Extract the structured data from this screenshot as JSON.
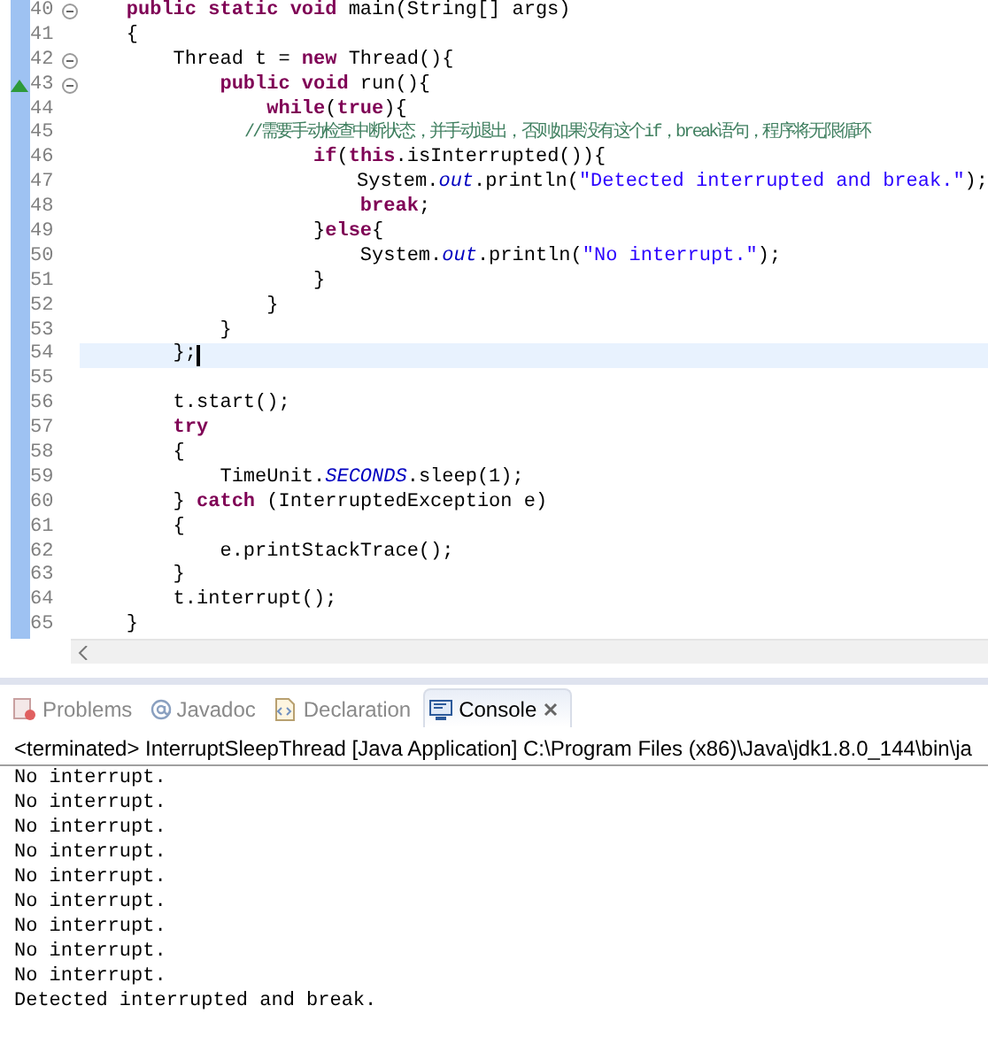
{
  "editor": {
    "lines": [
      {
        "number": "40",
        "fold": true,
        "current": false,
        "marker": false,
        "tokens": [
          {
            "kind": "keyword",
            "text": "    public static void"
          },
          {
            "kind": "plain",
            "text": " main(String[] args)"
          }
        ]
      },
      {
        "number": "41",
        "fold": false,
        "current": false,
        "marker": false,
        "tokens": [
          {
            "kind": "plain",
            "text": "    {"
          }
        ]
      },
      {
        "number": "42",
        "fold": true,
        "current": false,
        "marker": false,
        "tokens": [
          {
            "kind": "plain",
            "text": "        Thread t = "
          },
          {
            "kind": "keyword",
            "text": "new"
          },
          {
            "kind": "plain",
            "text": " Thread(){"
          }
        ]
      },
      {
        "number": "43",
        "fold": true,
        "current": false,
        "marker": true,
        "tokens": [
          {
            "kind": "keyword",
            "text": "            public void"
          },
          {
            "kind": "plain",
            "text": " run(){"
          }
        ]
      },
      {
        "number": "44",
        "fold": false,
        "current": false,
        "marker": false,
        "tokens": [
          {
            "kind": "keyword",
            "text": "                while"
          },
          {
            "kind": "plain",
            "text": "("
          },
          {
            "kind": "keyword",
            "text": "true"
          },
          {
            "kind": "plain",
            "text": "){"
          }
        ]
      },
      {
        "number": "45",
        "fold": false,
        "current": false,
        "marker": false,
        "tokens": [
          {
            "kind": "comment",
            "text": "                    //需要手动检查中断状态，并手动退出，否则如果没有这个if，break语句，程序将无限循环"
          }
        ]
      },
      {
        "number": "46",
        "fold": false,
        "current": false,
        "marker": false,
        "tokens": [
          {
            "kind": "keyword",
            "text": "                    if"
          },
          {
            "kind": "plain",
            "text": "("
          },
          {
            "kind": "keyword",
            "text": "this"
          },
          {
            "kind": "plain",
            "text": ".isInterrupted()){"
          }
        ]
      },
      {
        "number": "47",
        "fold": false,
        "current": false,
        "marker": false,
        "tokens": [
          {
            "kind": "plain",
            "text": "                        System."
          },
          {
            "kind": "field",
            "text": "out"
          },
          {
            "kind": "plain",
            "text": ".println("
          },
          {
            "kind": "string",
            "text": "\"Detected interrupted and break.\""
          },
          {
            "kind": "plain",
            "text": ");"
          }
        ]
      },
      {
        "number": "48",
        "fold": false,
        "current": false,
        "marker": false,
        "tokens": [
          {
            "kind": "keyword",
            "text": "                        break"
          },
          {
            "kind": "plain",
            "text": ";"
          }
        ]
      },
      {
        "number": "49",
        "fold": false,
        "current": false,
        "marker": false,
        "tokens": [
          {
            "kind": "plain",
            "text": "                    }"
          },
          {
            "kind": "keyword",
            "text": "else"
          },
          {
            "kind": "plain",
            "text": "{"
          }
        ]
      },
      {
        "number": "50",
        "fold": false,
        "current": false,
        "marker": false,
        "tokens": [
          {
            "kind": "plain",
            "text": "                        System."
          },
          {
            "kind": "field",
            "text": "out"
          },
          {
            "kind": "plain",
            "text": ".println("
          },
          {
            "kind": "string",
            "text": "\"No interrupt.\""
          },
          {
            "kind": "plain",
            "text": ");"
          }
        ]
      },
      {
        "number": "51",
        "fold": false,
        "current": false,
        "marker": false,
        "tokens": [
          {
            "kind": "plain",
            "text": "                    }"
          }
        ]
      },
      {
        "number": "52",
        "fold": false,
        "current": false,
        "marker": false,
        "tokens": [
          {
            "kind": "plain",
            "text": "                }"
          }
        ]
      },
      {
        "number": "53",
        "fold": false,
        "current": false,
        "marker": false,
        "tokens": [
          {
            "kind": "plain",
            "text": "            }"
          }
        ]
      },
      {
        "number": "54",
        "fold": false,
        "current": true,
        "marker": false,
        "tokens": [
          {
            "kind": "plain",
            "text": "        };"
          }
        ]
      },
      {
        "number": "55",
        "fold": false,
        "current": false,
        "marker": false
      },
      {
        "number": "56",
        "fold": false,
        "current": false,
        "marker": false,
        "tokens": [
          {
            "kind": "plain",
            "text": "        t.start();"
          }
        ]
      },
      {
        "number": "57",
        "fold": false,
        "current": false,
        "marker": false,
        "tokens": [
          {
            "kind": "keyword",
            "text": "        try"
          }
        ]
      },
      {
        "number": "58",
        "fold": false,
        "current": false,
        "marker": false,
        "tokens": [
          {
            "kind": "plain",
            "text": "        {"
          }
        ]
      },
      {
        "number": "59",
        "fold": false,
        "current": false,
        "marker": false,
        "tokens": [
          {
            "kind": "plain",
            "text": "            TimeUnit."
          },
          {
            "kind": "field",
            "text": "SECONDS"
          },
          {
            "kind": "plain",
            "text": ".sleep(1);"
          }
        ]
      },
      {
        "number": "60",
        "fold": false,
        "current": false,
        "marker": false,
        "tokens": [
          {
            "kind": "plain",
            "text": "        } "
          },
          {
            "kind": "keyword",
            "text": "catch"
          },
          {
            "kind": "plain",
            "text": " (InterruptedException e)"
          }
        ]
      },
      {
        "number": "61",
        "fold": false,
        "current": false,
        "marker": false,
        "tokens": [
          {
            "kind": "plain",
            "text": "        {"
          }
        ]
      },
      {
        "number": "62",
        "fold": false,
        "current": false,
        "marker": false,
        "tokens": [
          {
            "kind": "plain",
            "text": "            e.printStackTrace();"
          }
        ]
      },
      {
        "number": "63",
        "fold": false,
        "current": false,
        "marker": false,
        "tokens": [
          {
            "kind": "plain",
            "text": "        }"
          }
        ]
      },
      {
        "number": "64",
        "fold": false,
        "current": false,
        "marker": false,
        "tokens": [
          {
            "kind": "plain",
            "text": "        t.interrupt();"
          }
        ]
      },
      {
        "number": "65",
        "fold": false,
        "current": false,
        "marker": false,
        "tokens": [
          {
            "kind": "plain",
            "text": "    }"
          }
        ]
      }
    ]
  },
  "tabs": [
    {
      "label": "Problems",
      "kind": "problems",
      "selected": false
    },
    {
      "label": "Javadoc",
      "kind": "javadoc",
      "selected": false
    },
    {
      "label": "Declaration",
      "kind": "declaration",
      "selected": false
    },
    {
      "label": "Console",
      "kind": "console",
      "selected": true
    }
  ],
  "console": {
    "header": "<terminated> InterruptSleepThread [Java Application] C:\\Program Files (x86)\\Java\\jdk1.8.0_144\\bin\\ja",
    "lines": [
      "No interrupt.",
      "No interrupt.",
      "No interrupt.",
      "No interrupt.",
      "No interrupt.",
      "No interrupt.",
      "No interrupt.",
      "No interrupt.",
      "No interrupt.",
      "Detected interrupted and break."
    ]
  }
}
